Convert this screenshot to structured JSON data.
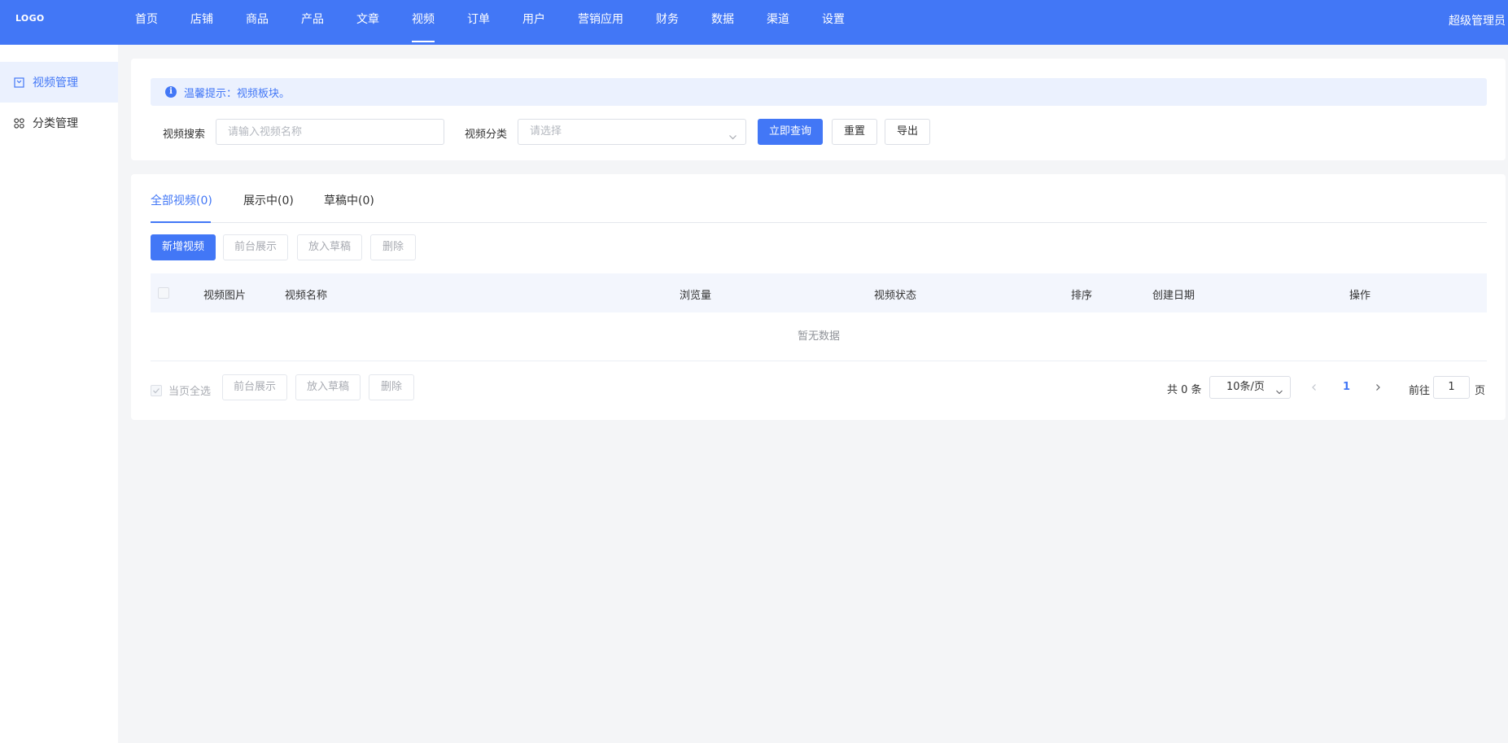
{
  "header": {
    "logo": "LOGO",
    "nav": [
      "首页",
      "店铺",
      "商品",
      "产品",
      "文章",
      "视频",
      "订单",
      "用户",
      "营销应用",
      "财务",
      "数据",
      "渠道",
      "设置"
    ],
    "active_nav": "视频",
    "user": "超级管理员"
  },
  "sidebar": {
    "items": [
      {
        "label": "视频管理",
        "icon": "video-box-icon",
        "active": true
      },
      {
        "label": "分类管理",
        "icon": "category-grid-icon",
        "active": false
      }
    ]
  },
  "filter": {
    "tip": "温馨提示：视频板块。",
    "search_label": "视频搜索",
    "search_placeholder": "请输入视频名称",
    "category_label": "视频分类",
    "category_placeholder": "请选择",
    "query_btn": "立即查询",
    "reset_btn": "重置",
    "export_btn": "导出"
  },
  "tabs": [
    {
      "label": "全部视频(0)",
      "active": true
    },
    {
      "label": "展示中(0)",
      "active": false
    },
    {
      "label": "草稿中(0)",
      "active": false
    }
  ],
  "actions": {
    "add": "新增视频",
    "show": "前台展示",
    "draft": "放入草稿",
    "delete": "删除"
  },
  "table": {
    "columns": [
      "视频图片",
      "视频名称",
      "浏览量",
      "视频状态",
      "排序",
      "创建日期",
      "操作"
    ],
    "empty_text": "暂无数据"
  },
  "footer": {
    "select_page": "当页全选",
    "show": "前台展示",
    "draft": "放入草稿",
    "delete": "删除",
    "total": "共 0 条",
    "page_size": "10条/页",
    "current_page": "1",
    "goto_label": "前往",
    "goto_value": "1",
    "page_suffix": "页"
  },
  "colors": {
    "primary": "#4277f6",
    "background": "#f4f5f7"
  }
}
